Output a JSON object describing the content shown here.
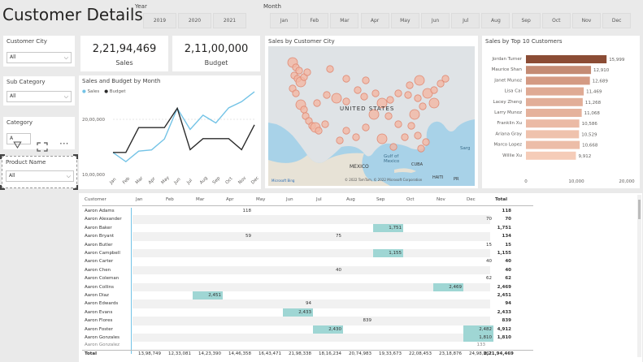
{
  "page": {
    "title": "Customer Details"
  },
  "year_slicer": {
    "label": "Year",
    "options": [
      "2019",
      "2020",
      "2021"
    ]
  },
  "month_slicer": {
    "label": "Month",
    "options": [
      "Jan",
      "Feb",
      "Mar",
      "Apr",
      "May",
      "Jun",
      "Jul",
      "Aug",
      "Sep",
      "Oct",
      "Nov",
      "Dec"
    ]
  },
  "filters": [
    {
      "label": "Customer City",
      "value": "All"
    },
    {
      "label": "Sub Category",
      "value": "All"
    },
    {
      "label": "Category",
      "value": "A"
    },
    {
      "label": "Product Name",
      "value": "All"
    }
  ],
  "kpis": {
    "sales": {
      "value": "2,21,94,469",
      "label": "Sales"
    },
    "budget": {
      "value": "2,11,00,000",
      "label": "Budget"
    }
  },
  "line_chart": {
    "title": "Sales and Budget by Month",
    "legend": [
      {
        "name": "Sales",
        "color": "#73c3e6"
      },
      {
        "name": "Budget",
        "color": "#2b2b2b"
      }
    ],
    "y_ticks": [
      "20,00,000",
      "10,00,000"
    ]
  },
  "map": {
    "title": "Sales by Customer City",
    "labels": {
      "country": "UNITED STATES",
      "mexico": "MEXICO",
      "gulf": "Gulf of\nMexico",
      "cuba": "CUBA",
      "haiti": "HAITI",
      "pr": "PR",
      "sarg": "Sarg"
    },
    "attribution": "© 2022 TomTom, © 2022 Microsoft Corporation",
    "brand": "Microsoft Bing"
  },
  "bar_chart": {
    "title": "Sales by Top 10 Customers",
    "x_ticks": [
      "0",
      "10,000",
      "20,000"
    ]
  },
  "matrix": {
    "header": {
      "customer": "Customer",
      "total": "Total"
    },
    "months": [
      "Jan",
      "Feb",
      "Mar",
      "Apr",
      "May",
      "Jun",
      "Jul",
      "Aug",
      "Oct",
      "Sep",
      "Nov",
      "Dec"
    ],
    "total_row": {
      "label": "Total",
      "values": [
        "13,98,749",
        "12,33,081",
        "14,23,390",
        "14,46,358",
        "16,43,471",
        "21,98,338",
        "18,16,234",
        "20,74,983",
        "19,33,673",
        "22,08,453",
        "23,18,876",
        "24,98,862"
      ],
      "total": "2,21,94,469"
    },
    "last_row_partial": "Aaron Gonzalez",
    "last_row_partial_value": "133"
  },
  "chart_data": [
    {
      "type": "line",
      "title": "Sales and Budget by Month",
      "x": [
        "Jan",
        "Feb",
        "Mar",
        "Apr",
        "May",
        "Jun",
        "Jul",
        "Aug",
        "Sep",
        "Oct",
        "Nov",
        "Dec"
      ],
      "ylim": [
        1000000,
        2500000
      ],
      "series": [
        {
          "name": "Sales",
          "values": [
            1398749,
            1233081,
            1423390,
            1446358,
            1643471,
            2198338,
            1816234,
            2074983,
            1933673,
            2208453,
            2318876,
            2498862
          ]
        },
        {
          "name": "Budget",
          "values": [
            1400000,
            1400000,
            1850000,
            1850000,
            1850000,
            2200000,
            1450000,
            1650000,
            1650000,
            1650000,
            1450000,
            1900000
          ]
        }
      ]
    },
    {
      "type": "bar",
      "title": "Sales by Top 10 Customers",
      "categories": [
        "Jordan Turner",
        "Maurice Shan",
        "Janet Munoz",
        "Lisa Cai",
        "Lacey Zheng",
        "Larry Munoz",
        "Franklin Xu",
        "Ariana Gray",
        "Marco Lopez",
        "Willie Xu"
      ],
      "values": [
        15999,
        12910,
        12689,
        11469,
        11268,
        11068,
        10586,
        10529,
        10668,
        9912
      ],
      "value_labels": [
        "15,999",
        "12,910",
        "12,689",
        "11,469",
        "11,268",
        "11,068",
        "10,586",
        "10,529",
        "10,668",
        "9,912"
      ],
      "xlim": [
        0,
        20000
      ]
    },
    {
      "type": "table",
      "rows": [
        {
          "name": "Aaron Adams",
          "cells": [
            {
              "m": 3,
              "v": "118"
            }
          ],
          "total": "118"
        },
        {
          "name": "Aaron Alexander",
          "cells": [
            {
              "m": 11,
              "v": "70"
            }
          ],
          "total": "70"
        },
        {
          "name": "Aaron Baker",
          "cells": [
            {
              "m": 8,
              "v": "1,751",
              "hl": true
            }
          ],
          "total": "1,751"
        },
        {
          "name": "Aaron Bryant",
          "cells": [
            {
              "m": 3,
              "v": "59"
            },
            {
              "m": 6,
              "v": "75"
            }
          ],
          "total": "134"
        },
        {
          "name": "Aaron Butler",
          "cells": [
            {
              "m": 11,
              "v": "15"
            }
          ],
          "total": "15"
        },
        {
          "name": "Aaron Campbell",
          "cells": [
            {
              "m": 8,
              "v": "1,155",
              "hl": true
            }
          ],
          "total": "1,155"
        },
        {
          "name": "Aaron Carter",
          "cells": [
            {
              "m": 11,
              "v": "40"
            }
          ],
          "total": "40"
        },
        {
          "name": "Aaron Chen",
          "cells": [
            {
              "m": 6,
              "v": "40"
            }
          ],
          "total": "40"
        },
        {
          "name": "Aaron Coleman",
          "cells": [
            {
              "m": 11,
              "v": "62"
            }
          ],
          "total": "62"
        },
        {
          "name": "Aaron Collins",
          "cells": [
            {
              "m": 10,
              "v": "2,469",
              "hl": true
            }
          ],
          "total": "2,469"
        },
        {
          "name": "Aaron Diaz",
          "cells": [
            {
              "m": 2,
              "v": "2,451",
              "hl": true
            }
          ],
          "total": "2,451"
        },
        {
          "name": "Aaron Edwards",
          "cells": [
            {
              "m": 5,
              "v": "94"
            }
          ],
          "total": "94"
        },
        {
          "name": "Aaron Evans",
          "cells": [
            {
              "m": 5,
              "v": "2,433",
              "hl": true
            }
          ],
          "total": "2,433"
        },
        {
          "name": "Aaron Flores",
          "cells": [
            {
              "m": 7,
              "v": "839"
            }
          ],
          "total": "839"
        },
        {
          "name": "Aaron Foster",
          "cells": [
            {
              "m": 6,
              "v": "2,430",
              "hl": true
            },
            {
              "m": 11,
              "v": "2,482",
              "hl": true
            }
          ],
          "total": "4,912"
        },
        {
          "name": "Aaron Gonzales",
          "cells": [
            {
              "m": 11,
              "v": "1,810",
              "hl": true
            }
          ],
          "total": "1,810"
        }
      ]
    }
  ]
}
